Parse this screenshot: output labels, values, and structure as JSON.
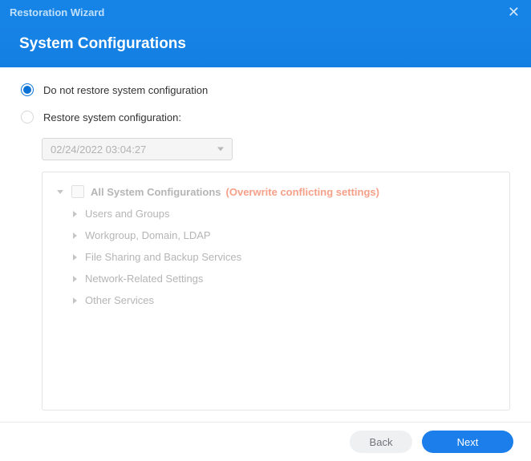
{
  "titlebar": {
    "title": "Restoration Wizard"
  },
  "header": {
    "title": "System Configurations"
  },
  "options": {
    "doNotRestore": {
      "label": "Do not restore system configuration",
      "selected": true
    },
    "restore": {
      "label": "Restore system configuration:",
      "selected": false
    }
  },
  "dropdown": {
    "value": "02/24/2022 03:04:27"
  },
  "tree": {
    "rootLabel": "All System Configurations",
    "rootWarning": "(Overwrite conflicting settings)",
    "children": [
      {
        "label": "Users and Groups"
      },
      {
        "label": "Workgroup, Domain, LDAP"
      },
      {
        "label": "File Sharing and Backup Services"
      },
      {
        "label": "Network-Related Settings"
      },
      {
        "label": "Other Services"
      }
    ]
  },
  "footer": {
    "back": "Back",
    "next": "Next"
  }
}
